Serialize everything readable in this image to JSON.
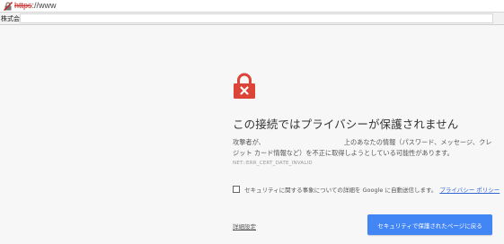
{
  "addressbar": {
    "url_scheme": "https",
    "url_rest": "://www",
    "lock_icon": "broken-lock-icon"
  },
  "bookmarks": {
    "label": "株式会社"
  },
  "interstitial": {
    "icon": "red-lock-x-icon",
    "accent": "#db4437",
    "title": "この接続ではプライバシーが保護されません",
    "message_prefix": "攻撃者が、",
    "message_suffix": "上のあなたの情報（パスワード、メッセージ、クレジット カード情報など）を不正に取得しようとしている可能性があります。",
    "error_code": "NET::ERR_CERT_DATE_INVALID",
    "optin_text": "セキュリティに関する事象についての詳細を Google に自動送信します。",
    "privacy_link": "プライバシー ポリシー",
    "details_link": "詳細設定",
    "back_button": "セキュリティで保護されたページに戻る",
    "button_color": "#4285f4"
  }
}
